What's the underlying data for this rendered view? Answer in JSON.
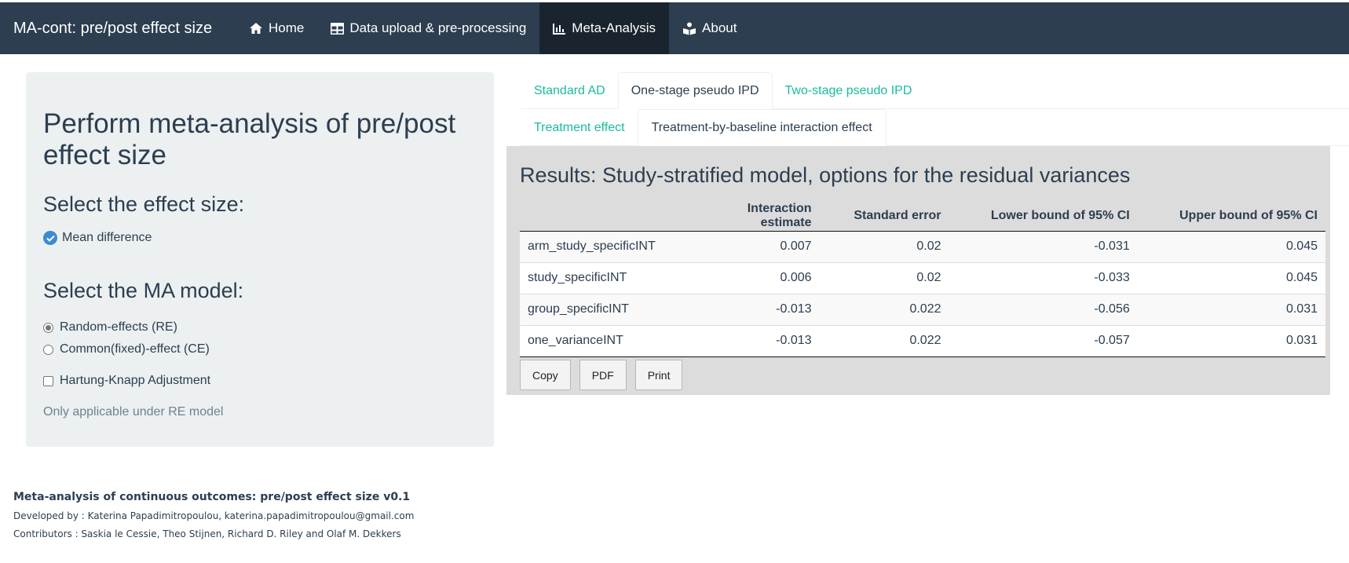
{
  "navbar": {
    "brand": "MA-cont: pre/post effect size",
    "items": [
      {
        "label": "Home",
        "icon": "home-icon"
      },
      {
        "label": "Data upload & pre-processing",
        "icon": "table-icon"
      },
      {
        "label": "Meta-Analysis",
        "icon": "bar-chart-icon"
      },
      {
        "label": "About",
        "icon": "book-reader-icon"
      }
    ],
    "active_item": "Meta-Analysis",
    "background": "#2c3e50"
  },
  "sidebar": {
    "title": "Perform meta-analysis of pre/post effect size",
    "effect_size_heading": "Select the effect size:",
    "effect_size_option": "Mean difference",
    "model_heading": "Select the MA model:",
    "model_options": [
      {
        "label": "Random-effects (RE)",
        "selected": true
      },
      {
        "label": "Common(fixed)-effect (CE)",
        "selected": false
      }
    ],
    "hk_label": "Hartung-Knapp Adjustment",
    "hk_checked": false,
    "hk_help": "Only applicable under RE model"
  },
  "tabs": {
    "main": [
      {
        "label": "Standard AD",
        "active": false
      },
      {
        "label": "One-stage pseudo IPD",
        "active": true
      },
      {
        "label": "Two-stage pseudo IPD",
        "active": false
      }
    ],
    "sub": [
      {
        "label": "Treatment effect",
        "active": false
      },
      {
        "label": "Treatment-by-baseline interaction effect",
        "active": true
      }
    ],
    "accent": "#18bc9c"
  },
  "results": {
    "title": "Results: Study-stratified model, options for the residual variances",
    "columns": [
      "",
      "Interaction estimate",
      "Standard error",
      "Lower bound of 95% CI",
      "Upper bound of 95% CI"
    ],
    "rows": [
      {
        "model": "arm_study_specificINT",
        "estimate": "0.007",
        "se": "0.02",
        "lower": "-0.031",
        "upper": "0.045"
      },
      {
        "model": "study_specificINT",
        "estimate": "0.006",
        "se": "0.02",
        "lower": "-0.033",
        "upper": "0.045"
      },
      {
        "model": "group_specificINT",
        "estimate": "-0.013",
        "se": "0.022",
        "lower": "-0.056",
        "upper": "0.031"
      },
      {
        "model": "one_varianceINT",
        "estimate": "-0.013",
        "se": "0.022",
        "lower": "-0.057",
        "upper": "0.031"
      }
    ],
    "buttons": {
      "copy": "Copy",
      "pdf": "PDF",
      "print": "Print"
    }
  },
  "footer": {
    "title": "Meta-analysis of continuous outcomes: pre/post effect size v0.1",
    "developed_by": "Developed by : Katerina Papadimitropoulou, katerina.papadimitropoulou@gmail.com",
    "contributors": "Contributors : Saskia le Cessie, Theo Stijnen, Richard D. Riley and Olaf M. Dekkers"
  }
}
